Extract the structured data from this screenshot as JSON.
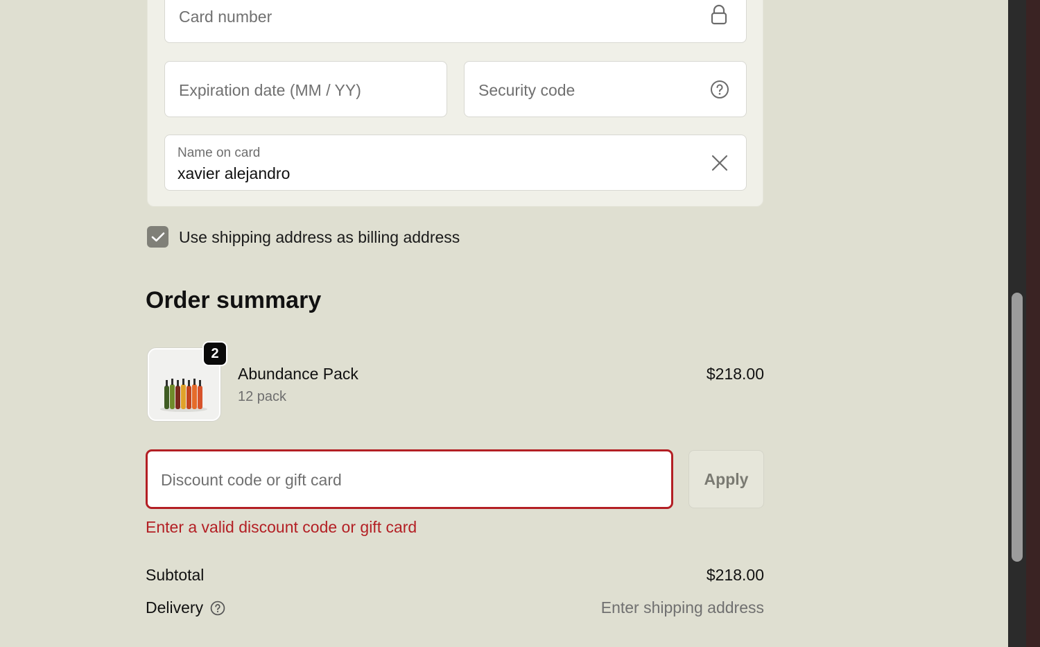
{
  "payment": {
    "card_number_placeholder": "Card number",
    "expiration_placeholder": "Expiration date (MM / YY)",
    "security_code_placeholder": "Security code",
    "name_label": "Name on card",
    "name_value": "xavier alejandro"
  },
  "billing": {
    "checkbox_label": "Use shipping address as billing address",
    "checked": true
  },
  "summary": {
    "title": "Order summary",
    "item": {
      "name": "Abundance Pack",
      "variant": "12 pack",
      "price": "$218.00",
      "quantity": "2"
    },
    "discount": {
      "placeholder": "Discount code or gift card",
      "apply_label": "Apply",
      "error": "Enter a valid discount code or gift card"
    },
    "subtotal_label": "Subtotal",
    "subtotal_value": "$218.00",
    "delivery_label": "Delivery",
    "delivery_value": "Enter shipping address"
  },
  "colors": {
    "background": "#dfdfd1",
    "error": "#b31f24",
    "checkbox": "#808078"
  },
  "icons": {
    "card_field": "lock-icon",
    "security_field": "help-circle-icon",
    "name_field": "close-icon",
    "delivery": "help-circle-icon"
  }
}
